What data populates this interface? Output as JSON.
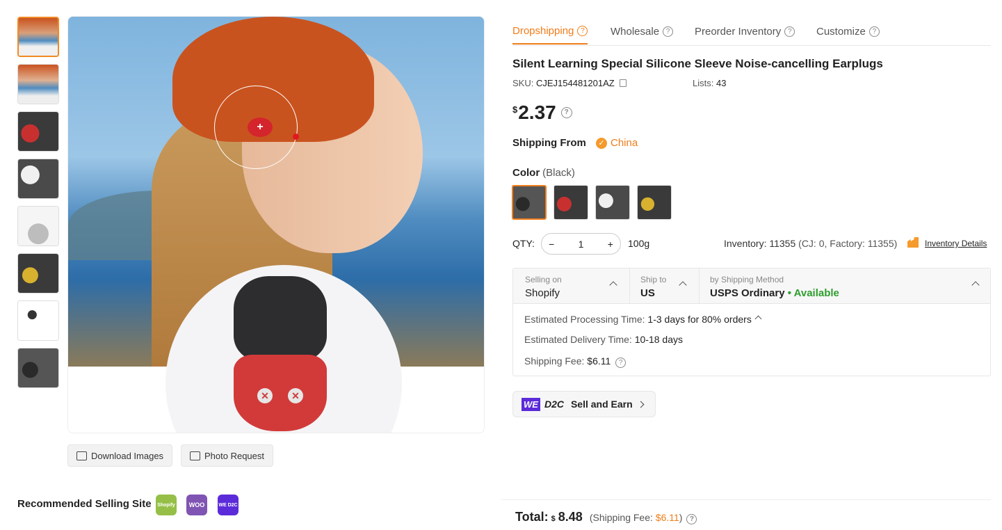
{
  "colors": {
    "accent": "#f07d1a",
    "available": "#2e9d2e",
    "d2c_brand": "#5c2bd9"
  },
  "thumbnails": [
    {
      "name": "woman-wearing-earplug"
    },
    {
      "name": "woman-profile"
    },
    {
      "name": "red-earplugs-case"
    },
    {
      "name": "white-earplugs-case"
    },
    {
      "name": "earplug-tips"
    },
    {
      "name": "yellow-earplugs-case"
    },
    {
      "name": "earplug-diagram"
    },
    {
      "name": "black-earplugs-case"
    }
  ],
  "image_actions": {
    "download": "Download Images",
    "photo_request": "Photo Request"
  },
  "recommended": {
    "label": "Recommended Selling Site",
    "sites": [
      "Shopify",
      "WOO",
      "WE D2C"
    ]
  },
  "tabs": [
    {
      "label": "Dropshipping",
      "active": true
    },
    {
      "label": "Wholesale"
    },
    {
      "label": "Preorder Inventory"
    },
    {
      "label": "Customize"
    }
  ],
  "product": {
    "title": "Silent Learning Special Silicone Sleeve Noise-cancelling Earplugs",
    "sku_label": "SKU:",
    "sku": "CJEJ154481201AZ",
    "lists_label": "Lists:",
    "lists": "43",
    "currency": "$",
    "price": "2.37"
  },
  "shipping_from": {
    "label": "Shipping From",
    "value": "China"
  },
  "color": {
    "label": "Color",
    "selected": "(Black)"
  },
  "qty": {
    "label": "QTY:",
    "value": "1",
    "minus": "−",
    "plus": "+",
    "weight": "100g"
  },
  "inventory": {
    "text": "Inventory: 11355",
    "detail": "(CJ: 0, Factory: 11355)",
    "link": "Inventory Details"
  },
  "shipping": {
    "selling_on_label": "Selling on",
    "selling_on": "Shopify",
    "ship_to_label": "Ship to",
    "ship_to": "US",
    "method_label": "by Shipping Method",
    "method": "USPS Ordinary",
    "availability": "• Available",
    "processing_label": "Estimated Processing Time:",
    "processing": "1-3 days for 80% orders",
    "delivery_label": "Estimated Delivery Time:",
    "delivery": "10-18 days",
    "fee_label": "Shipping Fee:",
    "fee": "$6.11"
  },
  "d2c": {
    "we": "WE",
    "d2c": "D2C",
    "label": "Sell and Earn"
  },
  "total": {
    "label": "Total:",
    "currency": "$",
    "value": "8.48",
    "fee_label": "(Shipping Fee:",
    "fee": "$6.11",
    "fee_close": ")"
  }
}
